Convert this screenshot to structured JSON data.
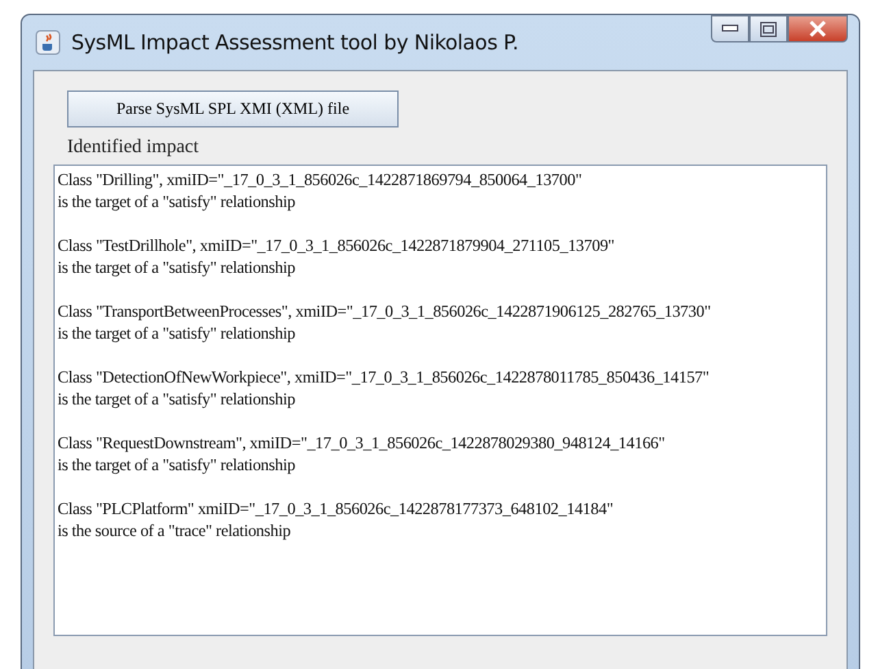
{
  "window": {
    "title": "SysML Impact Assessment tool by Nikolaos P."
  },
  "parse_button": {
    "label": "Parse SysML SPL XMI (XML) file"
  },
  "impact_label": "Identified impact",
  "impacts": [
    {
      "line_1": "Class \"Drilling\", xmiID=\"_17_0_3_1_856026c_1422871869794_850064_13700\"",
      "line_2": "is the target of a \"satisfy\" relationship"
    },
    {
      "line_1": "Class \"TestDrillhole\", xmiID=\"_17_0_3_1_856026c_1422871879904_271105_13709\"",
      "line_2": "is the target of a \"satisfy\" relationship"
    },
    {
      "line_1": "Class \"TransportBetweenProcesses\", xmiID=\"_17_0_3_1_856026c_1422871906125_282765_13730\"",
      "line_2": "is the target of a \"satisfy\" relationship"
    },
    {
      "line_1": "Class \"DetectionOfNewWorkpiece\", xmiID=\"_17_0_3_1_856026c_1422878011785_850436_14157\"",
      "line_2": "is the target of a \"satisfy\" relationship"
    },
    {
      "line_1": "Class \"RequestDownstream\", xmiID=\"_17_0_3_1_856026c_1422878029380_948124_14166\"",
      "line_2": "is the target of a \"satisfy\" relationship"
    },
    {
      "line_1": "Class \"PLCPlatform\" xmiID=\"_17_0_3_1_856026c_1422878177373_648102_14184\"",
      "line_2": "is the source of a \"trace\" relationship"
    }
  ]
}
